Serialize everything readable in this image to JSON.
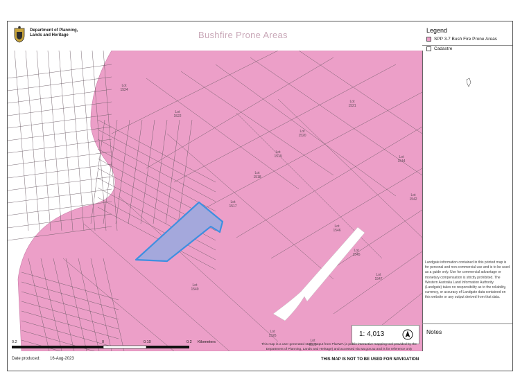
{
  "header": {
    "dept_line1": "Department of Planning,",
    "dept_line2": "Lands and Heritage",
    "map_title": "Bushfire Prone Areas"
  },
  "legend": {
    "title": "Legend",
    "items": [
      {
        "label": "SPP 3.7 Bush Fire Prone Areas",
        "color": "#ec9fc8"
      },
      {
        "label": "Cadastre",
        "color": "#ffffff"
      }
    ]
  },
  "lot_labels": [
    {
      "text": "Lot\n1524"
    },
    {
      "text": "Lot\n1522"
    },
    {
      "text": "Lot\n1521"
    },
    {
      "text": "Lot\n1520"
    },
    {
      "text": "Lot\n1519"
    },
    {
      "text": "Lot\n1518"
    },
    {
      "text": "Lot\n1517"
    },
    {
      "text": "Lot\n1544"
    },
    {
      "text": "Lot\n1542"
    },
    {
      "text": "Lot\n1546"
    },
    {
      "text": "Lot\n1545"
    },
    {
      "text": "Lot\n1547"
    },
    {
      "text": "Lot\n1549"
    },
    {
      "text": "Lot\n1526"
    },
    {
      "text": "Lot\n1525"
    }
  ],
  "scale": {
    "ratio": "1: 4,013",
    "bar_labels": [
      "0.2",
      "0",
      "0.10",
      "0.2"
    ],
    "units": "Kilometers"
  },
  "footer": {
    "date_label": "Date produced:",
    "date_value": "16-Aug-2023",
    "footnote": "This map is a user generated static output from PlanWA (a public interactive mapping tool provided by the Department of Planning, Lands and Heritage) and accessed via wa.gov.au and is for reference only",
    "warning": "THIS MAP IS NOT TO BE USED FOR NAVIGATION"
  },
  "disclaimer": "Landgate information contained in this printed map is for personal and non-commercial use and is to be used as a guide only. Use for commercial advantage or monetary compensation is strictly prohibited. The Western Australia Land Information Authority (Landgate) takes no responsibility as to the reliability, currency, or accuracy of Landgate data contained on this website or any output derived from that data.",
  "notes_title": "Notes"
}
